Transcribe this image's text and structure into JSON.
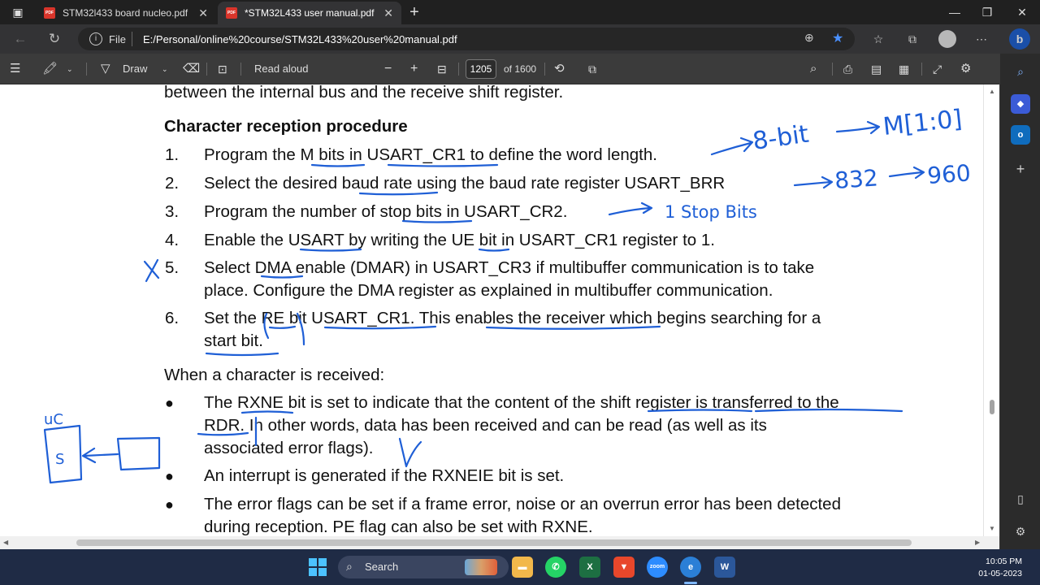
{
  "browser": {
    "tabs": [
      {
        "label": "STM32l433 board nucleo.pdf",
        "active": false
      },
      {
        "label": "*STM32L433 user manual.pdf",
        "active": true
      }
    ],
    "address": {
      "file_label": "File",
      "url": "E:/Personal/online%20course/STM32L433%20user%20manual.pdf"
    }
  },
  "pdf_toolbar": {
    "draw_label": "Draw",
    "read_aloud_label": "Read aloud",
    "page_current": "1205",
    "page_total": "of 1600"
  },
  "document": {
    "top_line": "between the internal bus and the receive shift register.",
    "heading": "Character reception procedure",
    "steps": [
      {
        "num": "1.",
        "lines": [
          "Program the M bits in USART_CR1 to define the word length."
        ]
      },
      {
        "num": "2.",
        "lines": [
          "Select the desired baud rate using the baud rate register USART_BRR"
        ]
      },
      {
        "num": "3.",
        "lines": [
          "Program the number of stop bits in USART_CR2."
        ]
      },
      {
        "num": "4.",
        "lines": [
          "Enable the USART by writing the UE bit in USART_CR1 register to 1."
        ]
      },
      {
        "num": "5.",
        "lines": [
          "Select DMA enable (DMAR) in USART_CR3 if multibuffer communication is to take",
          "place. Configure the DMA register as explained in multibuffer communication."
        ]
      },
      {
        "num": "6.",
        "lines": [
          "Set the RE bit USART_CR1. This enables the receiver which begins searching for a",
          "start bit."
        ]
      }
    ],
    "received_intro": "When a character is received:",
    "bullets": [
      {
        "lines": [
          "The RXNE bit is set to indicate that the content of the shift register is transferred to the",
          "RDR. In other words, data has been received and can be read (as well as its",
          "associated error flags)."
        ]
      },
      {
        "lines": [
          "An interrupt is generated if the RXNEIE bit is set."
        ]
      },
      {
        "lines": [
          "The error flags can be set if a frame error, noise or an overrun error has been detected",
          "during reception. PE flag can also be set with RXNE."
        ]
      }
    ],
    "annotations": {
      "word_length": "8-bit",
      "m_bits": "M[1:0]",
      "baud_a": "832",
      "baud_b": "960",
      "stop": "1 Stop Bits",
      "uc_label": "uC",
      "box_label": "S"
    },
    "ink_color": "#1f5fd6"
  },
  "taskbar": {
    "search_label": "Search",
    "time": "10:05 PM",
    "date": "01-05-2023"
  }
}
